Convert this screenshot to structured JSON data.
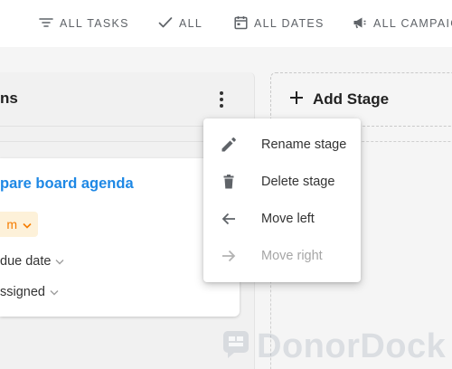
{
  "filters": {
    "tasks": "ALL TASKS",
    "all": "ALL",
    "dates": "ALL DATES",
    "campaigns": "ALL CAMPAIG"
  },
  "stage": {
    "title": "ns"
  },
  "card": {
    "title": "pare board agenda",
    "priority": "m",
    "due_date": "due date",
    "assignee": "ssigned"
  },
  "add_stage": {
    "label": "Add Stage"
  },
  "menu": {
    "items": [
      {
        "label": "Rename stage",
        "icon": "pencil-icon",
        "disabled": false
      },
      {
        "label": "Delete stage",
        "icon": "trash-icon",
        "disabled": false
      },
      {
        "label": "Move left",
        "icon": "arrow-left-icon",
        "disabled": false
      },
      {
        "label": "Move right",
        "icon": "arrow-right-icon",
        "disabled": true
      }
    ]
  },
  "watermark": {
    "text": "DonorDock"
  },
  "colors": {
    "link_blue": "#1e88e5",
    "priority_bg": "#fdf1d9",
    "priority_fg": "#f57c00",
    "muted": "#5f6368"
  }
}
